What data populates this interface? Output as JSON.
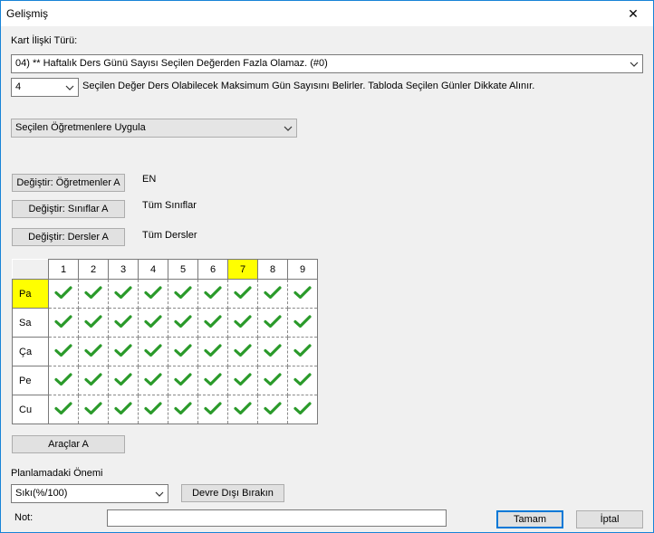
{
  "window": {
    "title": "Gelişmiş",
    "close_label": "✕"
  },
  "relation": {
    "label": "Kart İlişki Türü:",
    "selected": "04) ** Haftalık Ders Günü Sayısı Seçilen Değerden Fazla Olamaz. (#0)"
  },
  "value_row": {
    "selected": "4",
    "description": "Seçilen Değer Ders Olabilecek Maksimum Gün Sayısını Belirler. Tabloda Seçilen Günler Dikkate Alınır."
  },
  "apply": {
    "selected": "Seçilen Öğretmenlere Uygula"
  },
  "change_buttons": [
    {
      "label": "Değiştir: Öğretmenler A",
      "value": "EN"
    },
    {
      "label": "Değiştir: Sınıflar A",
      "value": "Tüm Sınıflar"
    },
    {
      "label": "Değiştir: Dersler A",
      "value": "Tüm Dersler"
    }
  ],
  "grid": {
    "columns": [
      "1",
      "2",
      "3",
      "4",
      "5",
      "6",
      "7",
      "8",
      "9"
    ],
    "highlighted_column": "7",
    "rows": [
      "Pa",
      "Sa",
      "Ça",
      "Pe",
      "Cu"
    ],
    "highlighted_row": "Pa",
    "cell_icon": "check-icon",
    "check_color": "#2a9a2a",
    "highlight_color": "#ffff00"
  },
  "tools_button": "Araçlar A",
  "importance": {
    "label": "Planlamadaki Önemi",
    "selected": "Sıkı(%/100)",
    "disable_button": "Devre Dışı Bırakın"
  },
  "note": {
    "label": "Not:",
    "value": ""
  },
  "footer": {
    "ok": "Tamam",
    "cancel": "İptal"
  }
}
